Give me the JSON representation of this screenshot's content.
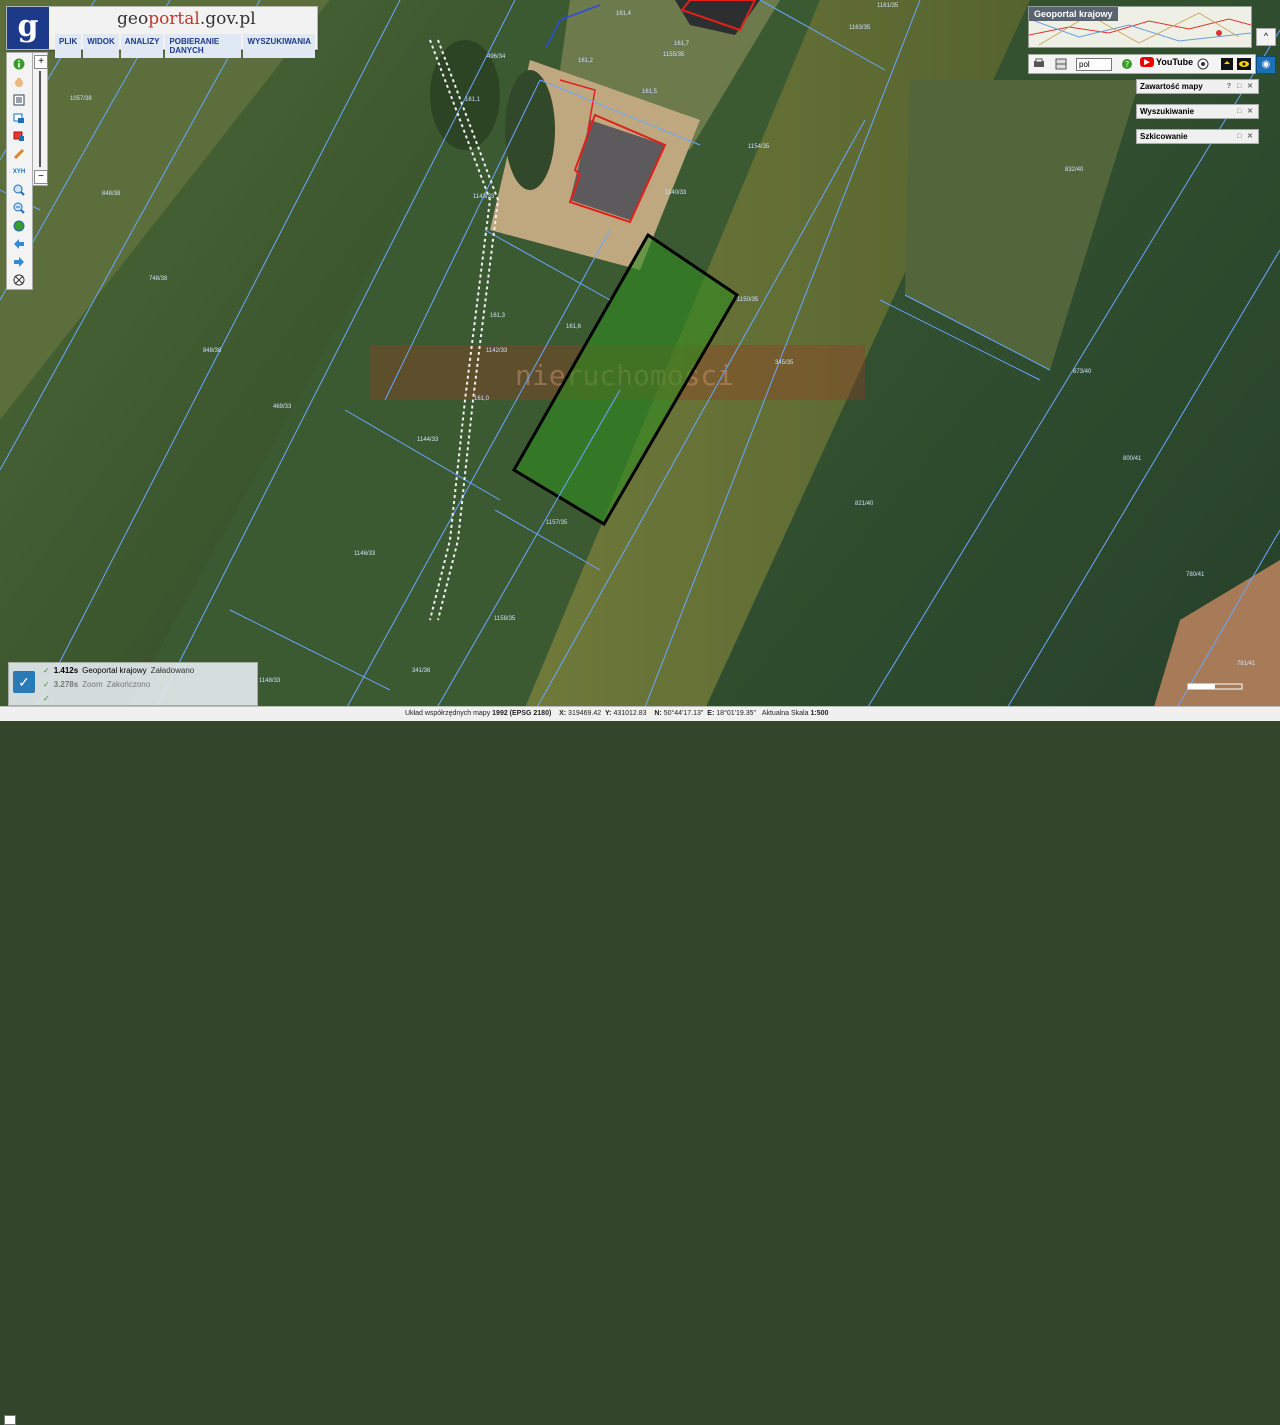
{
  "app": {
    "logo_letter": "g",
    "site_name_prefix": "geo",
    "site_name_accent": "portal",
    "site_name_suffix": ".gov.pl"
  },
  "menu": {
    "items": [
      "PLIK",
      "WIDOK",
      "ANALIZY",
      "POBIERANIE DANYCH",
      "WYSZUKIWANIA"
    ]
  },
  "left_toolbar": {
    "icons": [
      "info-icon",
      "hand-icon",
      "list-icon",
      "layers-icon",
      "red-edit-icon",
      "pencil-icon",
      "measure-icon",
      "zoom-in-icon",
      "zoom-out-icon",
      "globe-icon",
      "back-arrow-icon",
      "forward-arrow-icon",
      "crosshair-icon"
    ],
    "measure_label": "XYH"
  },
  "zoom": {
    "plus": "+",
    "minus": "−"
  },
  "minimap": {
    "title": "Geoportal krajowy",
    "collapse": "^"
  },
  "top_toolbar": {
    "language_value": "pol",
    "youtube_label": "YouTube",
    "eye_button_icon": "eye-icon"
  },
  "panels": [
    {
      "label": "Zawartość mapy",
      "ctrls": "? □ ✕"
    },
    {
      "label": "Wyszukiwanie",
      "ctrls": "□ ✕"
    },
    {
      "label": "Szkicowanie",
      "ctrls": "□ ✕"
    }
  ],
  "map": {
    "watermark_word": "nieruchomości",
    "labels": [
      "1057/38",
      "848/38",
      "748/38",
      "848/38",
      "469/33",
      "496/34",
      "1143/33",
      "1142/33",
      "1144/33",
      "1146/33",
      "1140/33",
      "1150/35",
      "1157/35",
      "1158/35",
      "1155/35",
      "1154/35",
      "1163/35",
      "1161/35",
      "345/35",
      "832/40",
      "873/40",
      "800/41",
      "821/40",
      "780/41",
      "781/41",
      "341/36",
      "1148/33",
      "161,4",
      "161,7",
      "161,2",
      "161,5",
      "161,3",
      "161,1",
      "161,6",
      "161,0"
    ]
  },
  "log": {
    "rows": [
      {
        "time": "1.412s",
        "service": "Geoportal krajowy",
        "status": "Załadowano"
      },
      {
        "time": "3.278s",
        "service": "Zoom",
        "status": "Zakończono"
      },
      {
        "time": "",
        "service": "",
        "status": ""
      }
    ]
  },
  "statusbar": {
    "prefix": "Układ współrzędnych mapy",
    "crs": "1992 (EPSG 2180)",
    "x_label": "X:",
    "x_value": "319469.42",
    "y_label": "Y:",
    "y_value": "431012.83",
    "n_label": "N:",
    "n_value": "50°44'17.13\"",
    "e_label": "E:",
    "e_value": "18°01'19.35\"",
    "scale_label": "Aktualna Skala",
    "scale_value": "1:500"
  },
  "colors": {
    "parcel_line": "#6aa6ff",
    "selected_fill": "#2f8a1f",
    "building_outline": "#e0201a",
    "accent": "#1d3a8a"
  }
}
